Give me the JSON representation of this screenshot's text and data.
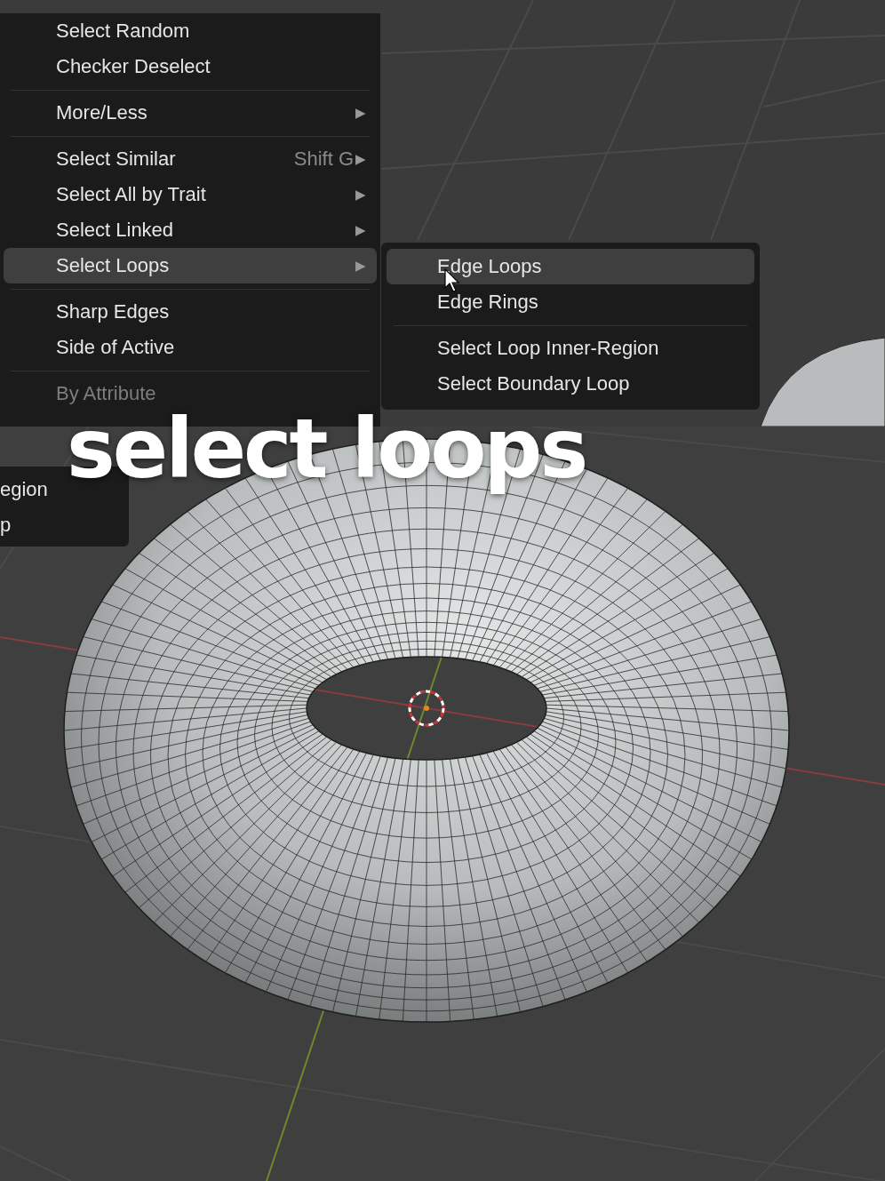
{
  "select_menu": {
    "items": [
      {
        "kind": "item",
        "label": "Select Random",
        "selected": false,
        "disabled": false
      },
      {
        "kind": "item",
        "label": "Checker Deselect",
        "selected": false,
        "disabled": false
      },
      {
        "kind": "separator"
      },
      {
        "kind": "item",
        "label": "More/Less",
        "submenu": "▶",
        "selected": false,
        "disabled": false
      },
      {
        "kind": "separator"
      },
      {
        "kind": "item",
        "label": "Select Similar",
        "shortcut": "Shift G",
        "submenu": "▶",
        "selected": false,
        "disabled": false
      },
      {
        "kind": "item",
        "label": "Select All by Trait",
        "submenu": "▶",
        "selected": false,
        "disabled": false
      },
      {
        "kind": "item",
        "label": "Select Linked",
        "submenu": "▶",
        "selected": false,
        "disabled": false
      },
      {
        "kind": "item",
        "label": "Select Loops",
        "submenu": "▶",
        "selected": true,
        "disabled": false
      },
      {
        "kind": "separator"
      },
      {
        "kind": "item",
        "label": "Sharp Edges",
        "selected": false,
        "disabled": false
      },
      {
        "kind": "item",
        "label": "Side of Active",
        "selected": false,
        "disabled": false
      },
      {
        "kind": "separator"
      },
      {
        "kind": "item",
        "label": "By Attribute",
        "selected": false,
        "disabled": true
      }
    ]
  },
  "loops_submenu": {
    "items": [
      {
        "kind": "item",
        "label": "Edge Loops",
        "selected": true
      },
      {
        "kind": "item",
        "label": "Edge Rings",
        "selected": false
      },
      {
        "kind": "separator"
      },
      {
        "kind": "item",
        "label": "Select Loop Inner-Region",
        "selected": false
      },
      {
        "kind": "item",
        "label": "Select Boundary Loop",
        "selected": false
      }
    ]
  },
  "partial_menu": {
    "items": [
      "egion",
      "p"
    ]
  },
  "caption": "select loops"
}
